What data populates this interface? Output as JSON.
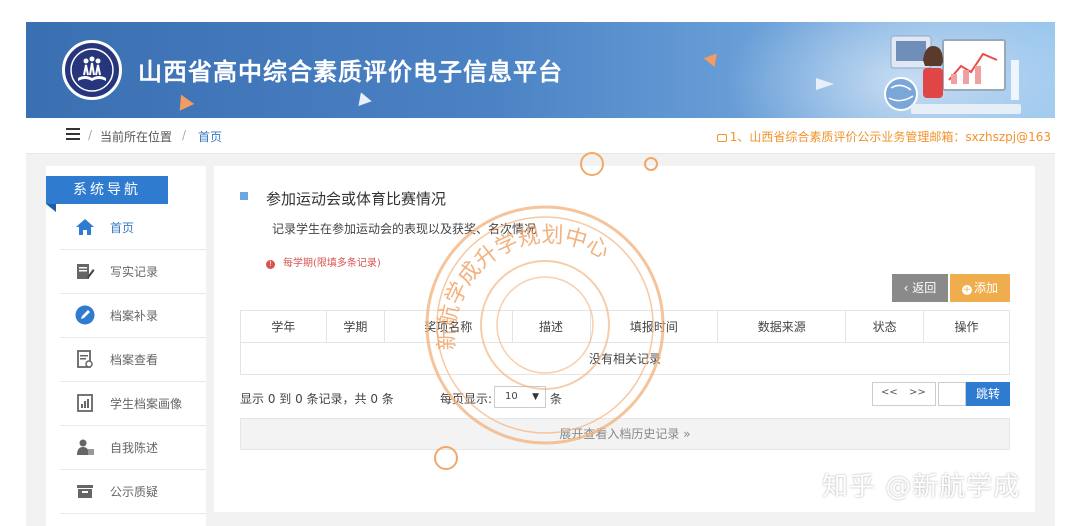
{
  "header": {
    "title": "山西省高中综合素质评价电子信息平台"
  },
  "breadcrumb": {
    "current_label": "当前所在位置",
    "home_label": "首页",
    "notice": "1、山西省综合素质评价公示业务管理邮箱：sxzhszpj@163"
  },
  "sidebar": {
    "heading": "系统导航",
    "items": [
      {
        "label": "首页",
        "icon": "home-icon",
        "active": true
      },
      {
        "label": "写实记录",
        "icon": "edit-icon"
      },
      {
        "label": "档案补录",
        "icon": "pencil-circle-icon"
      },
      {
        "label": "档案查看",
        "icon": "document-search-icon"
      },
      {
        "label": "学生档案画像",
        "icon": "chart-document-icon"
      },
      {
        "label": "自我陈述",
        "icon": "person-icon"
      },
      {
        "label": "公示质疑",
        "icon": "inbox-icon"
      }
    ]
  },
  "main": {
    "title": "参加运动会或体育比赛情况",
    "description": "记录学生在参加运动会的表现以及获奖、名次情况",
    "warning": "每学期(限填多条记录)",
    "back_button": "返回",
    "add_button": "添加",
    "table": {
      "columns": [
        "学年",
        "学期",
        "奖项名称",
        "描述",
        "填报时间",
        "数据来源",
        "状态",
        "操作"
      ],
      "empty_text": "没有相关记录"
    },
    "pagination": {
      "info": "显示 0 到 0 条记录，共 0 条",
      "per_page_label": "每页显示:",
      "per_page_value": "10",
      "per_page_suffix": "条",
      "prev": "<<",
      "next": ">>",
      "jump_button": "跳转"
    },
    "history_toggle": "展开查看入档历史记录 »"
  },
  "watermarks": {
    "stamp_text": "新航学成升学规划中心",
    "zhihu": "知乎 @新航学成"
  },
  "colors": {
    "banner": "#4b82c4",
    "accent_blue": "#2f7bd0",
    "add_orange": "#f0ad4e",
    "notice_orange": "#f0932b",
    "warning_red": "#d9534f"
  }
}
